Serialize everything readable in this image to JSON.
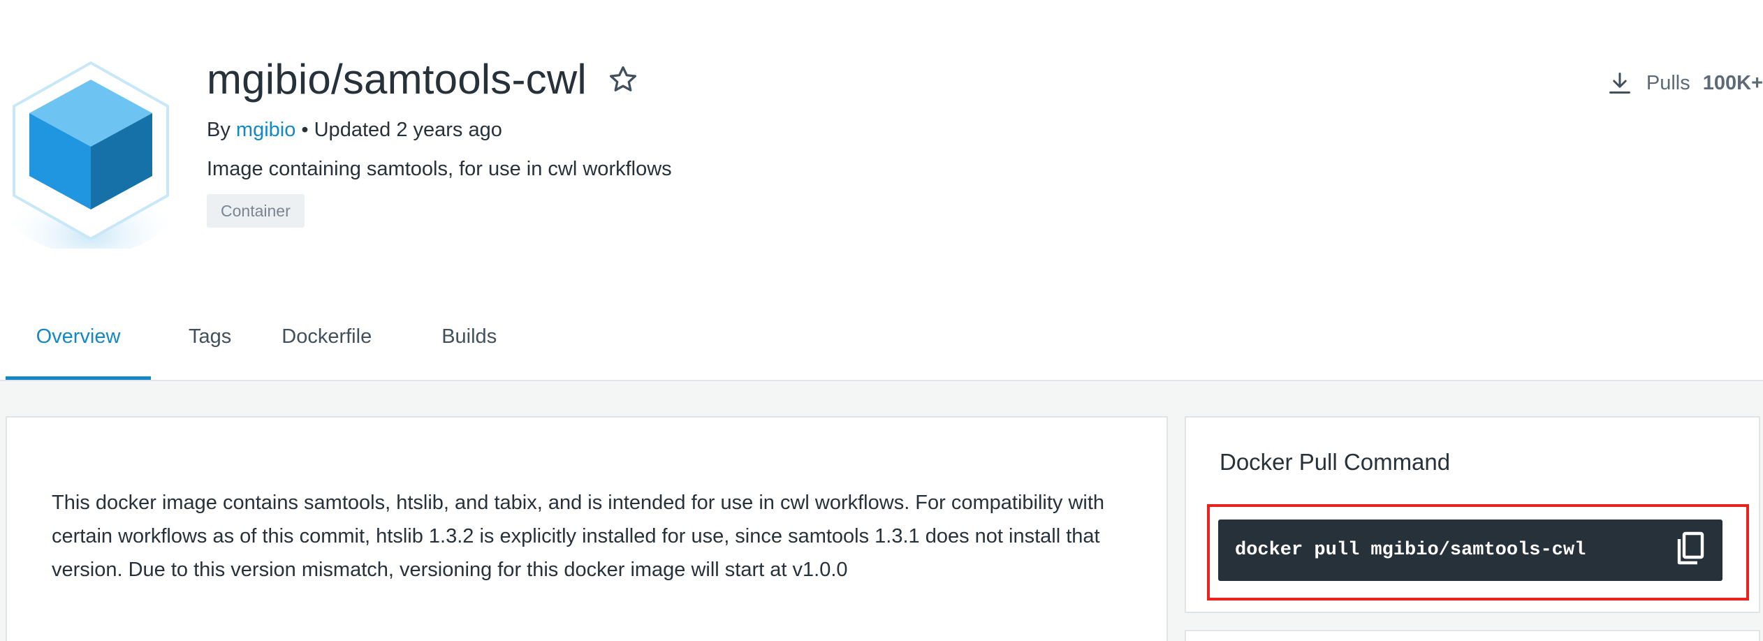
{
  "repo": {
    "title": "mgibio/samtools-cwl",
    "by_prefix": "By",
    "author": "mgibio",
    "updated": "• Updated 2 years ago",
    "description": "Image containing samtools, for use in cwl workflows",
    "badge": "Container"
  },
  "pulls": {
    "label": "Pulls",
    "count": "100K+"
  },
  "tabs": [
    {
      "label": "Overview",
      "active": true
    },
    {
      "label": "Tags",
      "active": false
    },
    {
      "label": "Dockerfile",
      "active": false
    },
    {
      "label": "Builds",
      "active": false
    }
  ],
  "readme": {
    "text": "This docker image contains samtools, htslib, and tabix, and is intended for use in cwl workflows. For compatibility with certain workflows as of this commit, htslib 1.3.2 is explicitly installed for use, since samtools 1.3.1 does not install that version. Due to this version mismatch, versioning for this docker image will start at v1.0.0"
  },
  "pull_command": {
    "heading": "Docker Pull Command",
    "command": "docker pull mgibio/samtools-cwl"
  },
  "icons": {
    "logo": "cube-logo-icon",
    "star": "star-icon",
    "download": "download-icon",
    "copy": "copy-icon"
  },
  "colors": {
    "accent": "#1488c6",
    "text": "#27313a",
    "command_bg": "#27313a",
    "highlight": "#e8231e",
    "content_bg": "#f4f5f5"
  }
}
